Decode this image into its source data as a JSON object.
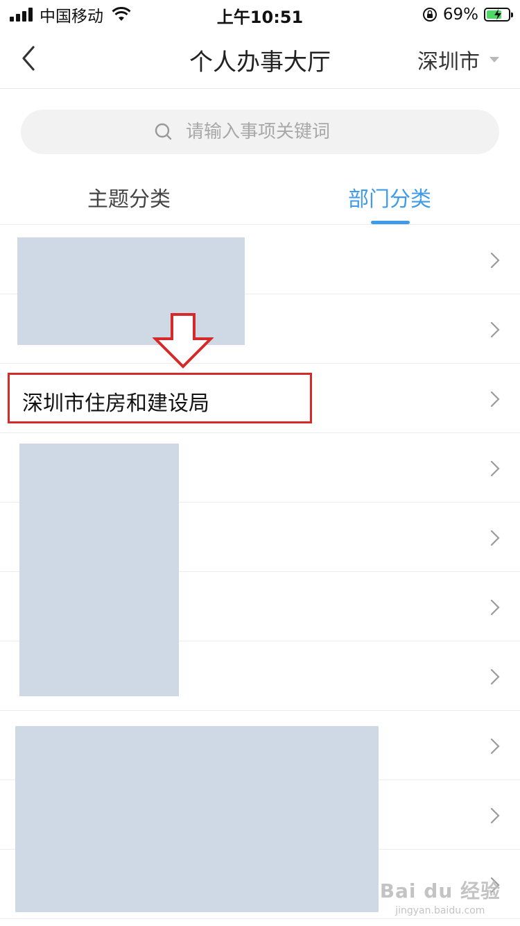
{
  "status_bar": {
    "carrier": "中国移动",
    "time": "上午10:51",
    "battery_percent": "69%",
    "battery_level": 0.69
  },
  "nav": {
    "title": "个人办事大厅",
    "city": "深圳市",
    "back_icon": "chevron-left-icon",
    "dropdown_icon": "caret-down-icon"
  },
  "search": {
    "placeholder": "请输入事项关键词",
    "icon": "search-icon"
  },
  "tabs": [
    {
      "label": "主题分类",
      "active": false
    },
    {
      "label": "部门分类",
      "active": true
    }
  ],
  "list": {
    "rows": [
      {
        "label": ""
      },
      {
        "label": ""
      },
      {
        "label": "深圳市住房和建设局"
      },
      {
        "label": ""
      },
      {
        "label": ""
      },
      {
        "label": ""
      },
      {
        "label": ""
      },
      {
        "label": ""
      },
      {
        "label": ""
      },
      {
        "label": ""
      }
    ]
  },
  "colors": {
    "accent": "#3d9be9",
    "annotation": "#d42a2a",
    "redaction": "#cfd9e6"
  },
  "watermark": {
    "logo": "Bai du 经验",
    "sub": "jingyan.baidu.com"
  }
}
